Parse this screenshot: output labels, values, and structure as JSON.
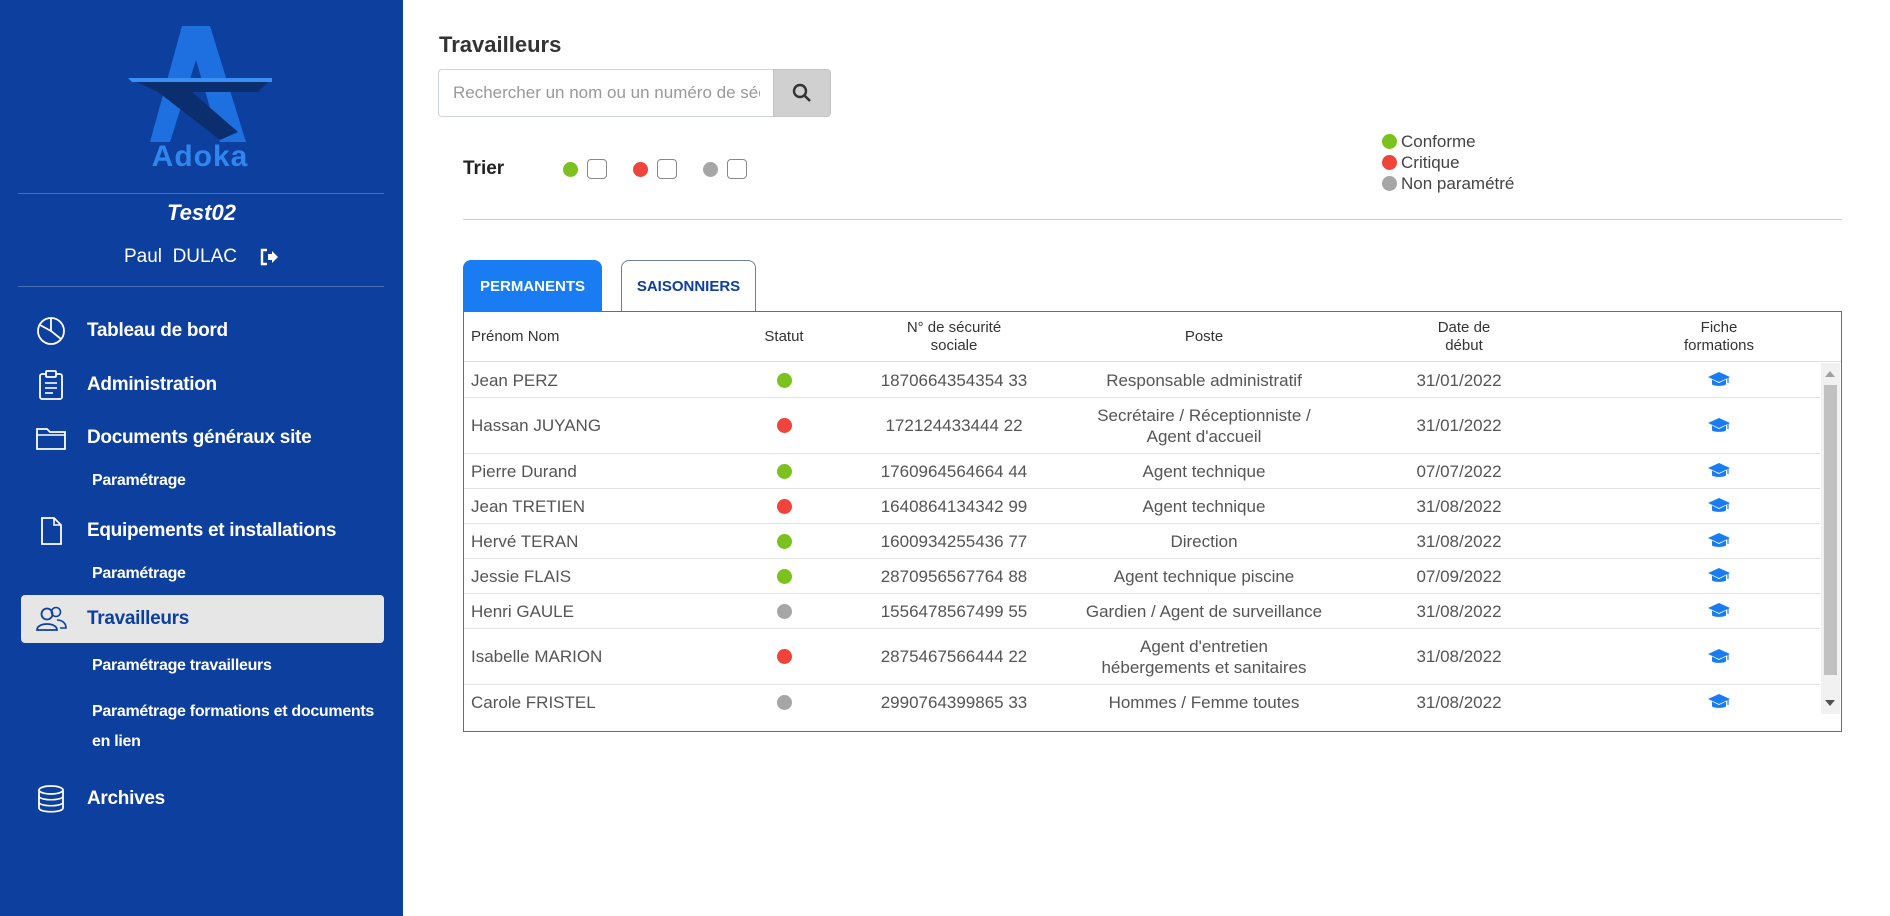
{
  "sidebar": {
    "logo_text": "Adoka",
    "site_name": "Test02",
    "user_name": "Paul  DULAC",
    "nav": [
      {
        "label": "Tableau de bord",
        "icon": "pie-chart-icon"
      },
      {
        "label": "Administration",
        "icon": "clipboard-icon"
      },
      {
        "label": "Documents généraux site",
        "icon": "folder-icon"
      },
      {
        "label": "Equipements et installations",
        "icon": "file-icon"
      },
      {
        "label": "Travailleurs",
        "icon": "users-icon"
      },
      {
        "label": "Archives",
        "icon": "database-icon"
      }
    ],
    "sub": {
      "documents_parametrage": "Paramétrage",
      "equipements_parametrage": "Paramétrage",
      "travailleurs_parametrage": "Paramétrage travailleurs",
      "formations_line1": "Paramétrage formations et documents",
      "formations_line2": "en lien"
    }
  },
  "main": {
    "title": "Travailleurs",
    "search_placeholder": "Rechercher un nom ou un numéro de sécurité sociale",
    "sort_label": "Trier",
    "legend": [
      {
        "label": "Conforme",
        "color": "#7cc21f"
      },
      {
        "label": "Critique",
        "color": "#f0433a"
      },
      {
        "label": "Non paramétré",
        "color": "#a6a6a6"
      }
    ],
    "tabs": [
      {
        "label": "PERMANENTS",
        "active": true
      },
      {
        "label": "SAISONNIERS",
        "active": false
      }
    ],
    "table": {
      "headers": {
        "name": "Prénom Nom",
        "status": "Statut",
        "ssn_line1": "N° de sécurité",
        "ssn_line2": "sociale",
        "poste": "Poste",
        "date_line1": "Date de",
        "date_line2": "début",
        "fiche_line1": "Fiche",
        "fiche_line2": "formations"
      },
      "rows": [
        {
          "name": "Jean PERZ",
          "status": "#7cc21f",
          "ssn": "1870664354354 33",
          "poste1": "Responsable administratif",
          "poste2": "",
          "date": "31/01/2022"
        },
        {
          "name": "Hassan JUYANG",
          "status": "#f0433a",
          "ssn": "172124433444 22",
          "poste1": "Secrétaire / Réceptionniste /",
          "poste2": "Agent d'accueil",
          "date": "31/01/2022"
        },
        {
          "name": "Pierre Durand",
          "status": "#7cc21f",
          "ssn": "1760964564664 44",
          "poste1": "Agent technique",
          "poste2": "",
          "date": "07/07/2022"
        },
        {
          "name": "Jean TRETIEN",
          "status": "#f0433a",
          "ssn": "1640864134342 99",
          "poste1": "Agent technique",
          "poste2": "",
          "date": "31/08/2022"
        },
        {
          "name": "Hervé TERAN",
          "status": "#7cc21f",
          "ssn": "1600934255436 77",
          "poste1": "Direction",
          "poste2": "",
          "date": "31/08/2022"
        },
        {
          "name": "Jessie FLAIS",
          "status": "#7cc21f",
          "ssn": "2870956567764 88",
          "poste1": "Agent technique piscine",
          "poste2": "",
          "date": "07/09/2022"
        },
        {
          "name": "Henri GAULE",
          "status": "#a6a6a6",
          "ssn": "1556478567499 55",
          "poste1": "Gardien / Agent de surveillance",
          "poste2": "",
          "date": "31/08/2022"
        },
        {
          "name": "Isabelle MARION",
          "status": "#f0433a",
          "ssn": "2875467566444 22",
          "poste1": "Agent d'entretien",
          "poste2": "hébergements et sanitaires",
          "date": "31/08/2022"
        },
        {
          "name": "Carole FRISTEL",
          "status": "#a6a6a6",
          "ssn": "2990764399865 33",
          "poste1": "Hommes / Femme toutes",
          "poste2": "",
          "date": "31/08/2022"
        }
      ]
    }
  }
}
